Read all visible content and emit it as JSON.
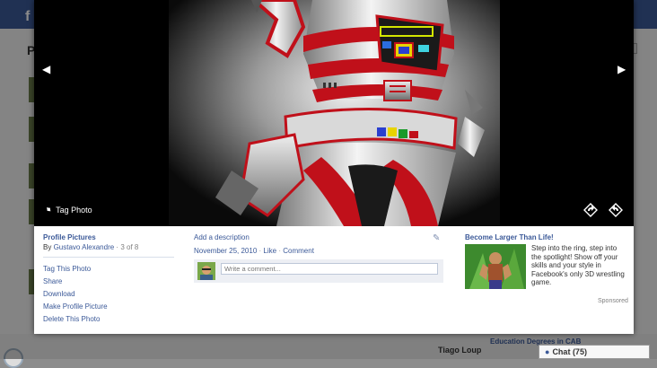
{
  "background": {
    "logo": "f",
    "page_heading_initial": "P",
    "bottom": {
      "friend_name": "Tiago Loup",
      "education_link": "Education Degrees in CAB",
      "chat_label": "Chat (75)"
    }
  },
  "viewer": {
    "tag_photo_label": "Tag Photo",
    "album": {
      "title": "Profile Pictures",
      "by_prefix": "By",
      "author": "Gustavo Alexandre",
      "count_separator": "·",
      "count": "3 of 8"
    },
    "actions": [
      "Tag This Photo",
      "Share",
      "Download",
      "Make Profile Picture",
      "Delete This Photo"
    ],
    "description_link": "Add a description",
    "meta": {
      "date": "November 25, 2010",
      "like": "Like",
      "comment": "Comment",
      "separator": "·"
    },
    "comment_placeholder": "Write a comment...",
    "ad": {
      "title": "Become Larger Than Life!",
      "text": "Step into the ring, step into the spotlight! Show off your skills and your style in Facebook's only 3D wrestling game.",
      "sponsored": "Sponsored"
    }
  },
  "colors": {
    "link": "#3b5998",
    "viewer_bg": "#000000",
    "fb_blue": "#3b5998"
  }
}
